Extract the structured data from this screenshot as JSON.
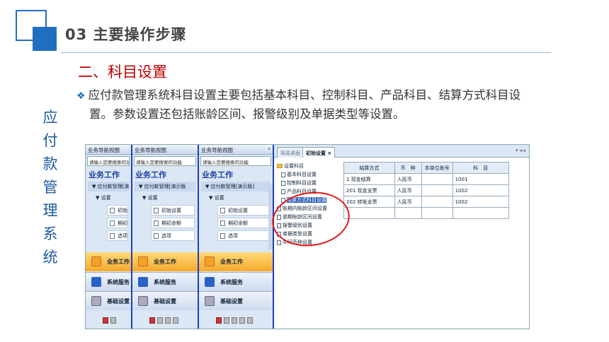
{
  "header": {
    "title": "03  主要操作步骤"
  },
  "vertical_title": [
    "应",
    "付",
    "款",
    "管",
    "理",
    "系",
    "统"
  ],
  "section": {
    "heading": "二、科目设置"
  },
  "bullet": {
    "text": "应付款管理系统科目设置主要包括基本科目、控制科目、产品科目、结算方式科目设置。参数设置还包括账龄区间、报警级别及单据类型等设置。"
  },
  "colors": {
    "accent": "#1f6fc1",
    "heading_red": "#c00000",
    "circle": "#e01818"
  },
  "panels": [
    {
      "title": "业务导航视图",
      "search": "请输入您要搜索的功",
      "heading": "业务工作",
      "group": "▼ 应付款管理[演",
      "sub": "▼ 设置",
      "items": [
        "初始设",
        "期初余",
        "选项"
      ]
    },
    {
      "title": "业务导航视图",
      "search": "请输入您要搜索的功能",
      "heading": "业务工作",
      "group": "▼ 应付款管理[演示版",
      "sub": "▼ 设置",
      "items": [
        "初始设置",
        "期初余额",
        "选项"
      ]
    },
    {
      "title": "业务导航视图",
      "search": "请输入您要搜索的功能",
      "heading": "业务工作",
      "group": "▼ 应付款管理[演示版]",
      "sub": "▼ 设置",
      "items": [
        "初始设置",
        "期初余额",
        "选项"
      ]
    }
  ],
  "nav_buttons": [
    "业务工作",
    "系统服务",
    "基础设置"
  ],
  "pin_icon": "pin-icon",
  "tabs": [
    "简易桌面",
    "初始设置 ×"
  ],
  "tab_controls": "▾ ◂ ▸",
  "tree": {
    "root": "设置科目",
    "children": [
      "基本科目设置",
      "控制科目设置",
      "产品科目设置",
      "结算方式科目设置"
    ],
    "others": [
      "账期内账龄区间设置",
      "逾期账龄区间设置",
      "报警级别设置",
      "单据类型设置",
      "中间币种设置"
    ]
  },
  "grid": {
    "headers": [
      "结算方式",
      "币　种",
      "本单位账号",
      "科　目"
    ],
    "rows": [
      [
        "1 现金结算",
        "人民币",
        "",
        "1001"
      ],
      [
        "201 现金支票",
        "人民币",
        "",
        "1002"
      ],
      [
        "202 转账支票",
        "人民币",
        "",
        "1002"
      ],
      [
        "",
        "",
        "",
        ""
      ]
    ]
  }
}
